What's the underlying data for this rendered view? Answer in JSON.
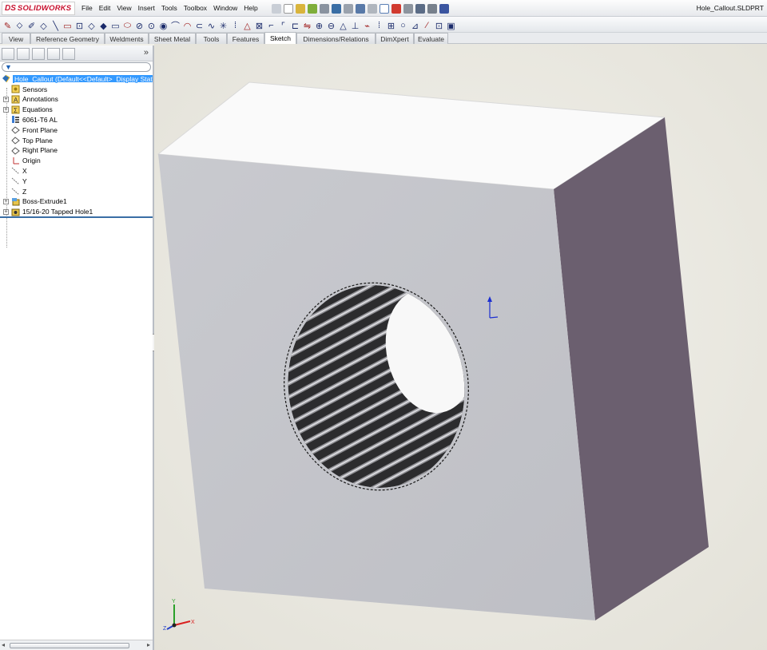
{
  "app": {
    "brand_ds": "DS",
    "brand_name": "SOLIDWORKS",
    "file_title": "Hole_Callout.SLDPRT"
  },
  "menu": [
    "File",
    "Edit",
    "View",
    "Insert",
    "Tools",
    "Toolbox",
    "Window",
    "Help"
  ],
  "tabs": [
    "View",
    "Reference Geometry",
    "Weldments",
    "Sheet Metal",
    "Tools",
    "Features",
    "Sketch",
    "Dimensions/Relations",
    "DimXpert",
    "Evaluate"
  ],
  "active_tab": "Sketch",
  "tree": {
    "root": "Hole_Callout  (Default<<Default>_Display State",
    "items": [
      {
        "label": "Sensors",
        "icon": "sensor-icon",
        "expandable": false
      },
      {
        "label": "Annotations",
        "icon": "annotation-icon",
        "expandable": true
      },
      {
        "label": "Equations",
        "icon": "equations-icon",
        "expandable": true
      },
      {
        "label": "6061-T6 AL",
        "icon": "material-icon",
        "expandable": false
      },
      {
        "label": "Front Plane",
        "icon": "plane-icon",
        "expandable": false
      },
      {
        "label": "Top Plane",
        "icon": "plane-icon",
        "expandable": false
      },
      {
        "label": "Right Plane",
        "icon": "plane-icon",
        "expandable": false
      },
      {
        "label": "Origin",
        "icon": "origin-icon",
        "expandable": false
      },
      {
        "label": "X",
        "icon": "axis-icon",
        "expandable": false
      },
      {
        "label": "Y",
        "icon": "axis-icon",
        "expandable": false
      },
      {
        "label": "Z",
        "icon": "axis-icon",
        "expandable": false
      },
      {
        "label": "Boss-Extrude1",
        "icon": "extrude-icon",
        "expandable": true
      },
      {
        "label": "15/16-20 Tapped Hole1",
        "icon": "hole-wizard-icon",
        "expandable": true
      }
    ]
  },
  "triad": {
    "x": "X",
    "y": "Y",
    "z": "Z"
  },
  "colors": {
    "selection": "#3399ff",
    "brand_red": "#c8102e",
    "part_front": "#c4c5cb",
    "part_top": "#fafafa",
    "part_side": "#6b5f6f",
    "viewport_bg": "#eeede6"
  }
}
